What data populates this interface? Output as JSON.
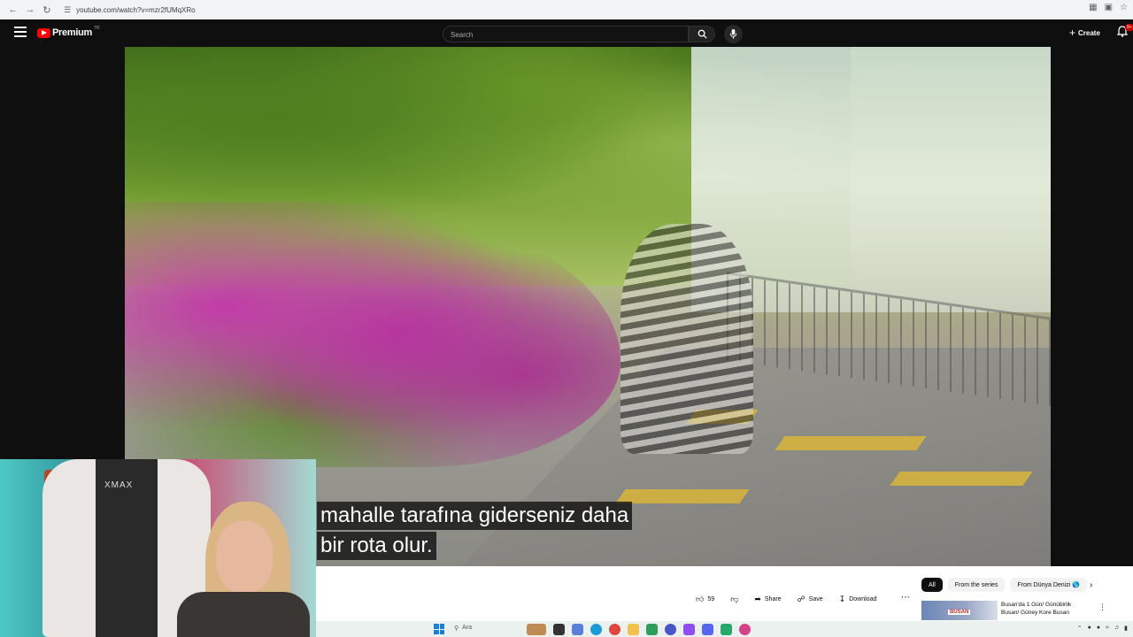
{
  "browser": {
    "url": "youtube.com/watch?v=mzr2fUMqXRo"
  },
  "header": {
    "logo_text": "Premium",
    "logo_region": "TR",
    "search_placeholder": "Search",
    "create_label": "Create",
    "notification_badge": "9+"
  },
  "video": {
    "subtitle_line1": "mahalle tarafına giderseniz daha",
    "subtitle_line2": "bir rota olur."
  },
  "webcam": {
    "chair_brand": "XMAX"
  },
  "actions": {
    "like_count": "59",
    "share_label": "Share",
    "save_label": "Save",
    "download_label": "Download"
  },
  "chips": [
    {
      "label": "All"
    },
    {
      "label": "From the series"
    },
    {
      "label": "From Dünya Denizi 🌎"
    }
  ],
  "recommendation": {
    "title": "Busan'da 1 Gün/ Günübirlik Busan/ Güney Kore Busan",
    "thumb_label": "BUSAN"
  },
  "taskbar": {
    "search_label": "Ara"
  }
}
